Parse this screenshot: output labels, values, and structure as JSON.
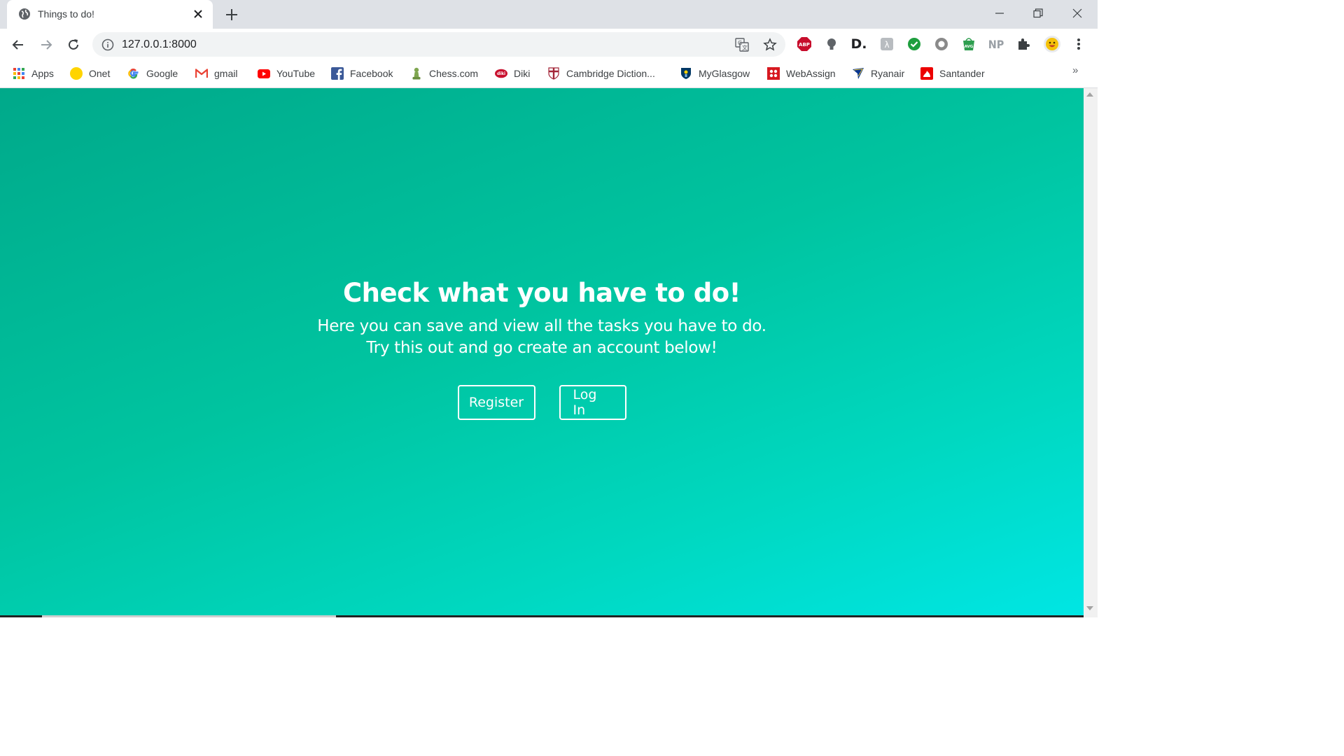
{
  "browser": {
    "tab": {
      "title": "Things to do!"
    },
    "address": {
      "url": "127.0.0.1:8000"
    },
    "extensions": [
      {
        "name": "adblock-plus-icon",
        "label": "ABP",
        "color": "#c70d2c"
      },
      {
        "name": "lightbulb-extension-icon",
        "label": "",
        "color": "#5f6368"
      },
      {
        "name": "dashlane-icon",
        "label": "D.",
        "color": "#202124"
      },
      {
        "name": "translate-ext-icon",
        "label": "",
        "color": "#9aa0a6"
      },
      {
        "name": "checkmark-extension-icon",
        "label": "",
        "color": "#1e9e3e"
      },
      {
        "name": "circle-extension-icon",
        "label": "",
        "color": "#7f7f7f"
      },
      {
        "name": "avg-icon",
        "label": "AVG",
        "color": "#2e9e4f"
      },
      {
        "name": "np-extension-icon",
        "label": "NP",
        "color": "#9aa0a6"
      }
    ],
    "bookmarks": [
      {
        "label": "Apps",
        "icon": "apps-grid-icon"
      },
      {
        "label": "Onet",
        "icon": "onet-icon",
        "color": "#ffd400"
      },
      {
        "label": "Google",
        "icon": "google-icon"
      },
      {
        "label": "gmail",
        "icon": "gmail-icon"
      },
      {
        "label": "YouTube",
        "icon": "youtube-icon",
        "color": "#ff0000"
      },
      {
        "label": "Facebook",
        "icon": "facebook-icon",
        "color": "#3b5998"
      },
      {
        "label": "Chess.com",
        "icon": "chess-pawn-icon",
        "color": "#7fa650"
      },
      {
        "label": "Diki",
        "icon": "diki-icon",
        "color": "#c8102e"
      },
      {
        "label": "Cambridge Diction...",
        "icon": "cambridge-shield-icon",
        "color": "#a32638"
      },
      {
        "label": "MyGlasgow",
        "icon": "glasgow-crest-icon",
        "color": "#003865"
      },
      {
        "label": "WebAssign",
        "icon": "webassign-icon",
        "color": "#d71920"
      },
      {
        "label": "Ryanair",
        "icon": "ryanair-icon",
        "color": "#073590"
      },
      {
        "label": "Santander",
        "icon": "santander-icon",
        "color": "#ec0000"
      }
    ],
    "bookmarks_overflow": "»"
  },
  "page": {
    "heading": "Check what you have to do!",
    "line1": "Here you can save and view all the tasks you have to do.",
    "line2": "Try this out and go create an account below!",
    "register_label": "Register",
    "login_label": "Log In",
    "gradient_start": "#00a98a",
    "gradient_end": "#00e6e4"
  }
}
